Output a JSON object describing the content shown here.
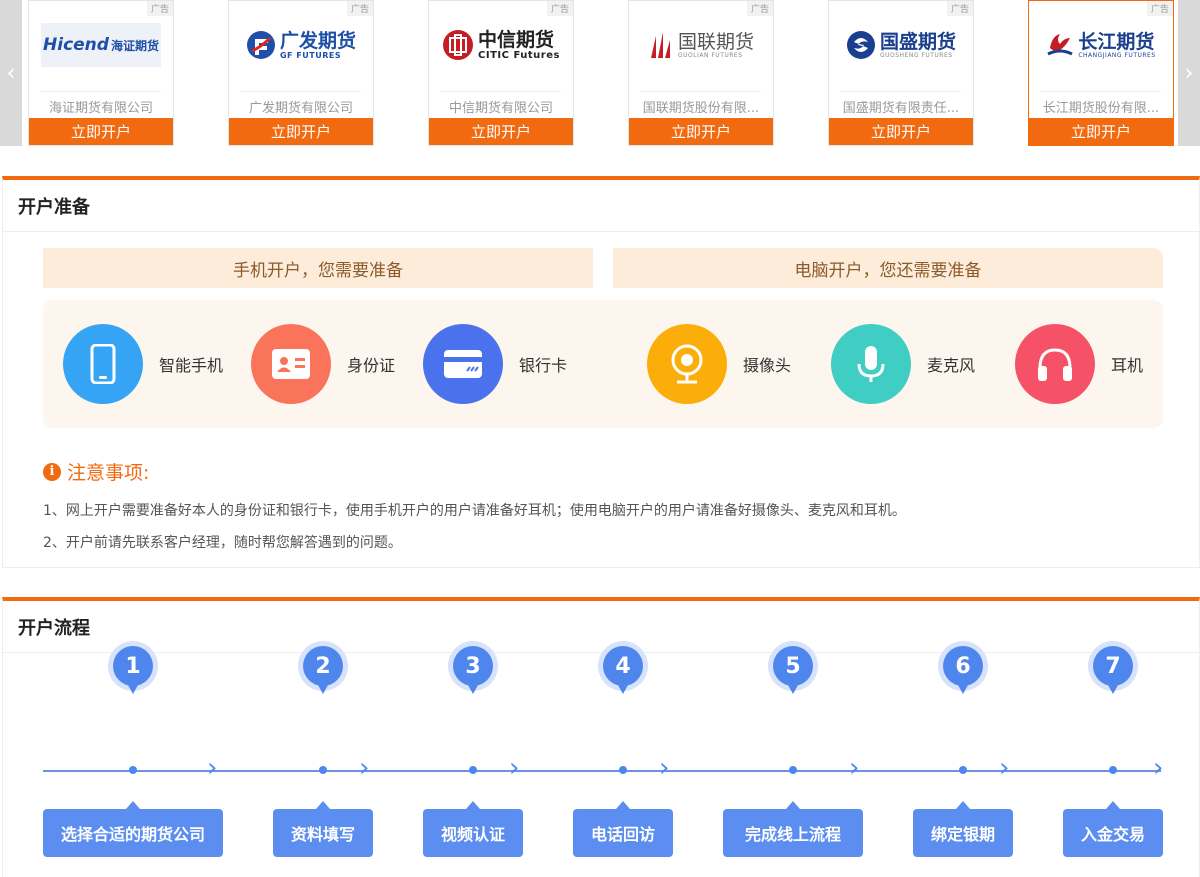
{
  "carousel": {
    "ad_label": "广告",
    "open_label": "立即开户",
    "left_arrow": "‹",
    "right_arrow": "›",
    "cards": [
      {
        "brand": "Hicend",
        "brand_cn": "海证期货",
        "sub": "",
        "company": "海证期货有限公司",
        "color": "#1f4fa8"
      },
      {
        "brand": "广发期货",
        "brand_cn": "",
        "sub": "GF FUTURES",
        "company": "广发期货有限公司",
        "color": "#1f4fa8"
      },
      {
        "brand": "中信期货",
        "brand_cn": "",
        "sub": "CITIC Futures",
        "company": "中信期货有限公司",
        "color": "#c41e24"
      },
      {
        "brand": "国联期货",
        "brand_cn": "",
        "sub": "GUOLIAN FUTURES",
        "company": "国联期货股份有限...",
        "color": "#c41e24"
      },
      {
        "brand": "国盛期货",
        "brand_cn": "",
        "sub": "GUOSHENG FUTURES",
        "company": "国盛期货有限责任...",
        "color": "#1a3f8f"
      },
      {
        "brand": "长江期货",
        "brand_cn": "",
        "sub": "CHANGJIANG FUTURES",
        "company": "长江期货股份有限...",
        "color": "#1a3f8f"
      }
    ]
  },
  "prep": {
    "title": "开户准备",
    "mobile_head": "手机开户，您需要准备",
    "pc_head": "电脑开户，您还需要准备",
    "items": [
      {
        "label": "智能手机",
        "icon": "smartphone-icon",
        "color": "#36a4f4"
      },
      {
        "label": "身份证",
        "icon": "id-card-icon",
        "color": "#f9745a"
      },
      {
        "label": "银行卡",
        "icon": "bank-card-icon",
        "color": "#4a72ec"
      },
      {
        "label": "摄像头",
        "icon": "webcam-icon",
        "color": "#fbad0a"
      },
      {
        "label": "麦克风",
        "icon": "microphone-icon",
        "color": "#3fcdc4"
      },
      {
        "label": "耳机",
        "icon": "headphones-icon",
        "color": "#f55268"
      }
    ],
    "notice_title": "注意事项:",
    "notice_icon": "i",
    "notes": [
      "1、网上开户需要准备好本人的身份证和银行卡，使用手机开户的用户请准备好耳机；使用电脑开户的用户请准备好摄像头、麦克风和耳机。",
      "2、开户前请先联系客户经理，随时帮您解答遇到的问题。"
    ]
  },
  "process": {
    "title": "开户流程",
    "chevron": "›",
    "steps": [
      {
        "num": "1",
        "label": "选择合适的期货公司"
      },
      {
        "num": "2",
        "label": "资料填写"
      },
      {
        "num": "3",
        "label": "视频认证"
      },
      {
        "num": "4",
        "label": "电话回访"
      },
      {
        "num": "5",
        "label": "完成线上流程"
      },
      {
        "num": "6",
        "label": "绑定银期"
      },
      {
        "num": "7",
        "label": "入金交易"
      }
    ]
  },
  "colors": {
    "accent": "#f26a10",
    "blue": "#4f86ee"
  }
}
